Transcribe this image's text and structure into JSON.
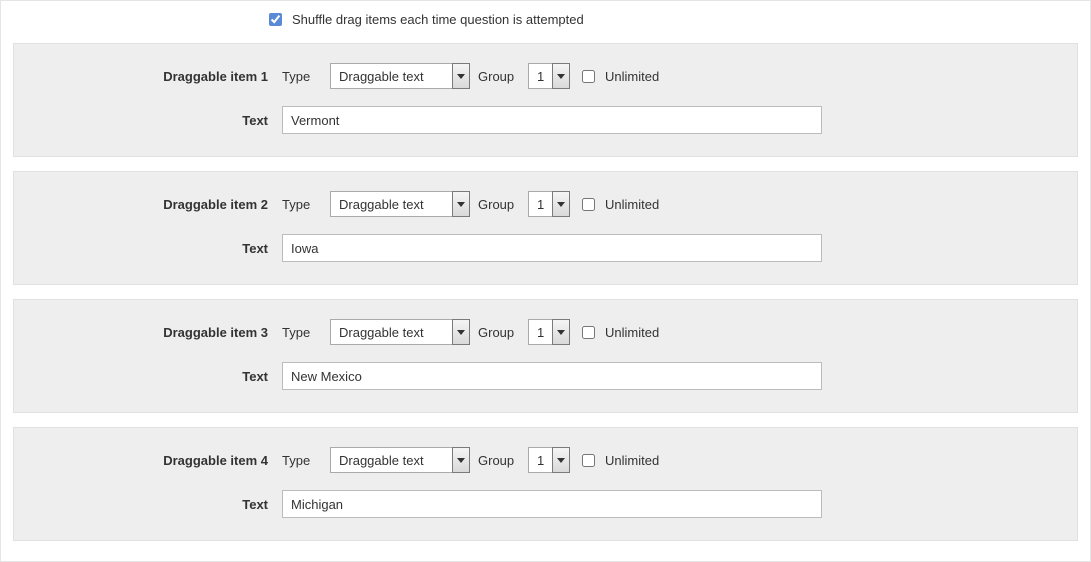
{
  "shuffle": {
    "checked": true,
    "label": "Shuffle drag items each time question is attempted"
  },
  "labels": {
    "type": "Type",
    "group": "Group",
    "unlimited": "Unlimited",
    "text": "Text"
  },
  "type_options": [
    "Draggable text"
  ],
  "group_options": [
    "1"
  ],
  "items": [
    {
      "title": "Draggable item 1",
      "type_value": "Draggable text",
      "group_value": "1",
      "unlimited_checked": false,
      "text_value": "Vermont"
    },
    {
      "title": "Draggable item 2",
      "type_value": "Draggable text",
      "group_value": "1",
      "unlimited_checked": false,
      "text_value": "Iowa"
    },
    {
      "title": "Draggable item 3",
      "type_value": "Draggable text",
      "group_value": "1",
      "unlimited_checked": false,
      "text_value": "New Mexico"
    },
    {
      "title": "Draggable item 4",
      "type_value": "Draggable text",
      "group_value": "1",
      "unlimited_checked": false,
      "text_value": "Michigan"
    }
  ]
}
